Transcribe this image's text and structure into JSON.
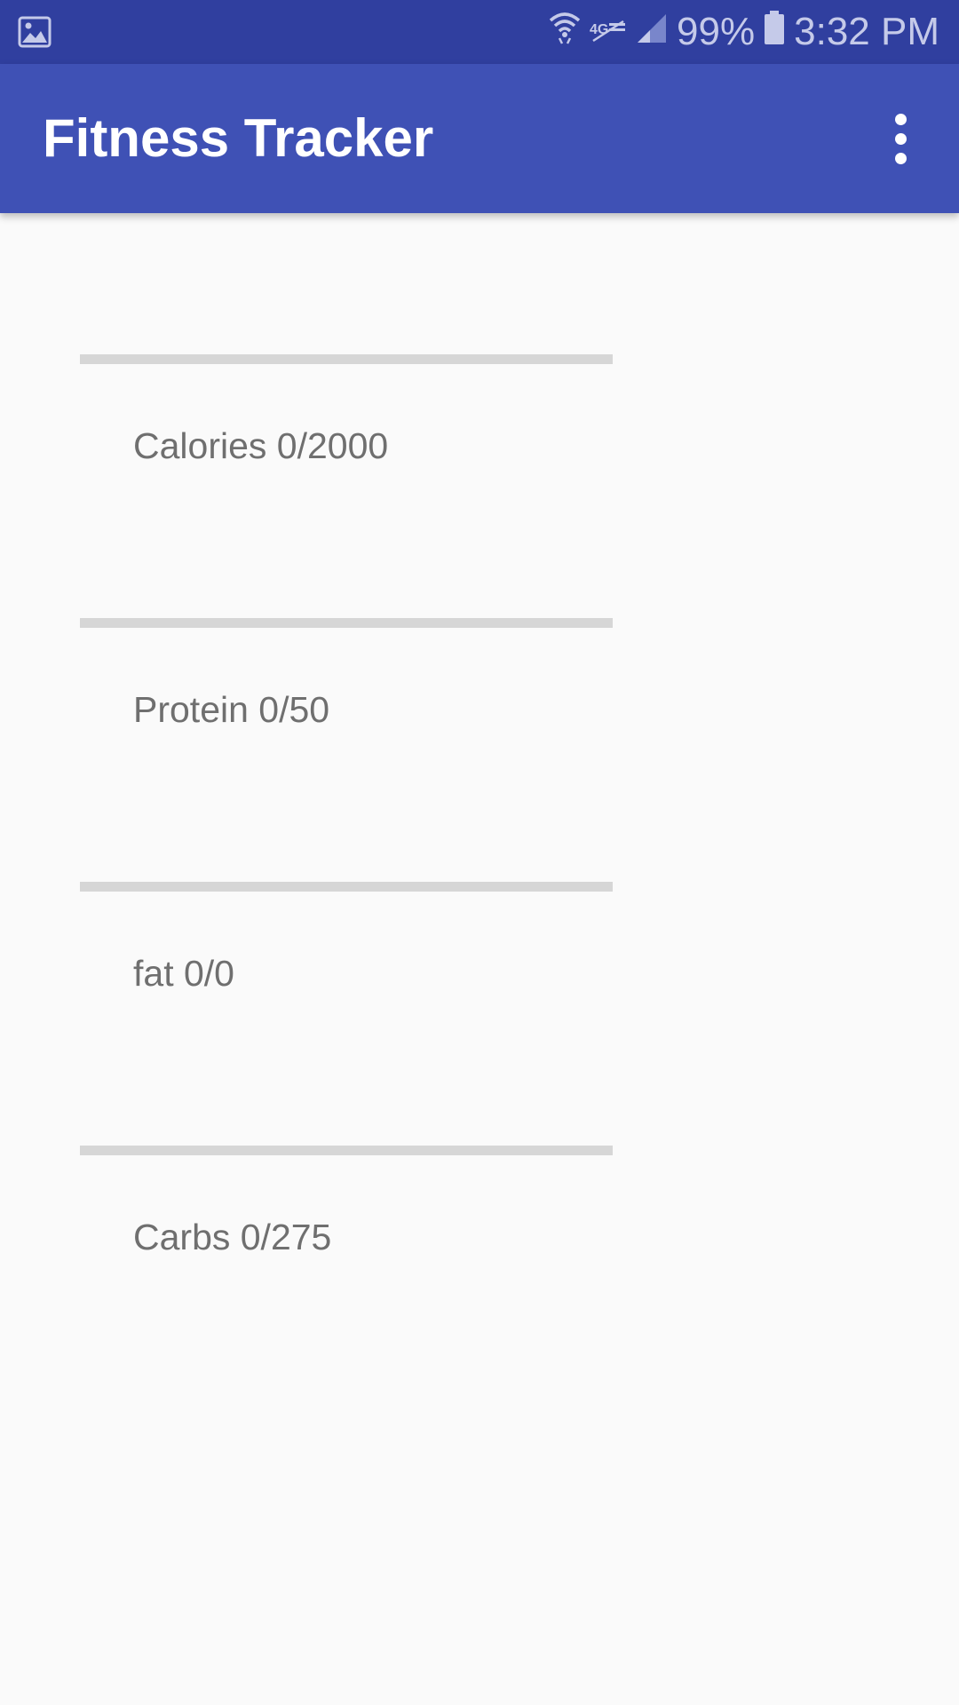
{
  "status_bar": {
    "battery_percent": "99%",
    "time": "3:32 PM",
    "icons": [
      "image-notification-icon",
      "wifi-icon",
      "4g-lte-icon",
      "signal-icon",
      "battery-icon"
    ]
  },
  "app_bar": {
    "title": "Fitness Tracker",
    "menu_icon": "more-vert-icon",
    "background_color": "#3f51b5",
    "status_bar_color": "#303f9f"
  },
  "metrics": [
    {
      "label": "Calories 0/2000",
      "progress": 0
    },
    {
      "label": "Protein 0/50",
      "progress": 0
    },
    {
      "label": "fat 0/0",
      "progress": 0
    },
    {
      "label": "Carbs 0/275",
      "progress": 0
    }
  ]
}
